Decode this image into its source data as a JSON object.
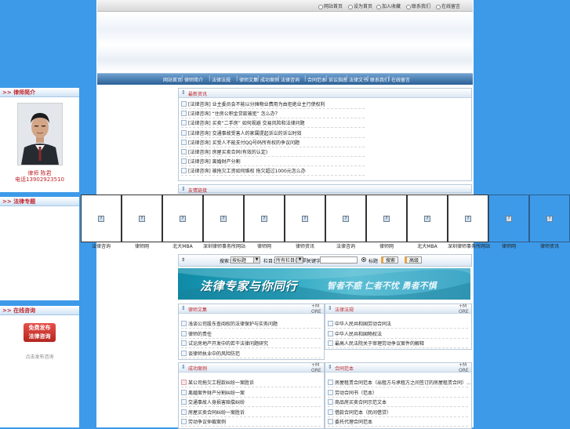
{
  "top_links": [
    "网站首页",
    "设为首页",
    "加入收藏",
    "联系我们",
    "在线留言"
  ],
  "nav_items": [
    "网站首页",
    "律师简介",
    "法律法规",
    "律师文集",
    "成功案例",
    "法律咨询",
    "合同范本",
    "诉讼指南",
    "法律文书",
    "联系我们",
    "在线留言"
  ],
  "left": {
    "profile": {
      "title": ">> 律师简介",
      "name": "律师 陈君",
      "phone": "电话13902923510"
    },
    "panel2": {
      "title": ">> 法律专题"
    },
    "panel3": {
      "title": ">> 在线咨询",
      "button": "免费发布\n法律咨询",
      "caption": "点击发布咨询"
    }
  },
  "news": {
    "title": "最新资讯",
    "items": [
      "[法律咨询] 业主委员会不能以分摊物业费用为由拒绝业主行使权利",
      "[法律咨询] “住房公积金贷款被拒” 怎么办？",
      "[法律咨询] 买卖“二手房” 如何规避 交易风险和法律问题",
      "[法律咨询] 交通事故受害人的家属提起诉讼的诉讼时效",
      "[法律咨询] 买受人不能支付QQ号码所有权的争议问题",
      "[法律咨询] 房屋买卖合同(有效的认定)",
      "[法律咨询] 离婚财产分割",
      "[法律咨询] 被拖欠工资如何维权 拖欠超过1000元怎么办"
    ]
  },
  "links": {
    "title": "友情链接"
  },
  "thumbnails": [
    {
      "caption": "法律咨询",
      "blue": false
    },
    {
      "caption": "律师网",
      "blue": false
    },
    {
      "caption": "北大MBA",
      "blue": false
    },
    {
      "caption": "深圳律师事务所网站",
      "blue": false
    },
    {
      "caption": "律师网",
      "blue": false
    },
    {
      "caption": "律师资讯",
      "blue": false
    },
    {
      "caption": "法律咨询",
      "blue": false
    },
    {
      "caption": "律师网",
      "blue": false
    },
    {
      "caption": "北大MBA",
      "blue": false
    },
    {
      "caption": "深圳律师事务所网站",
      "blue": false
    },
    {
      "caption": "律师网",
      "blue": true
    },
    {
      "caption": "律师资讯",
      "blue": true
    }
  ],
  "search": {
    "label1": "搜索：",
    "select1": "按标题",
    "label2": "栏目：",
    "select2": "所有栏目(全部)",
    "label3": "关键字：",
    "radio_label": "标题",
    "btn1": "搜索",
    "btn2": "高级"
  },
  "slogan": {
    "main": "法律专家与你同行",
    "sub": "智者不惑 仁者不忧 勇者不惧"
  },
  "boxes": [
    {
      "title": "律师文集",
      "more": "+MORE",
      "items": [
        "浅谈公司股东查阅权的法律保护与实务问题",
        "律师的责任",
        "试论房地产开发中的若干法律问题研究",
        "谈律师执业中的风险防范"
      ]
    },
    {
      "title": "法律法规",
      "more": "+MORE",
      "items": [
        "中华人民共和国劳动合同法",
        "中华人民共和国物权法",
        "最高人民法院关于审理劳动争议案件的解释"
      ]
    },
    {
      "title": "成功案例",
      "more": "+MORE",
      "items": [
        "某公司拖欠工程款纠纷一案胜诉",
        "离婚案件财产分割纠纷一案",
        "交通事故人身损害赔偿纠纷",
        "房屋买卖合同纠纷一案胜诉",
        "劳动争议仲裁案例"
      ]
    },
    {
      "title": "合同范本",
      "more": "+MORE",
      "items": [
        "房屋租赁合同范本（出租方与承租方之间签订的房屋租赁合同）...",
        "劳动合同书（范本）",
        "商品房买卖合同示范文本",
        "借款合同范本（民间借贷）",
        "委托代理合同范本"
      ]
    }
  ]
}
